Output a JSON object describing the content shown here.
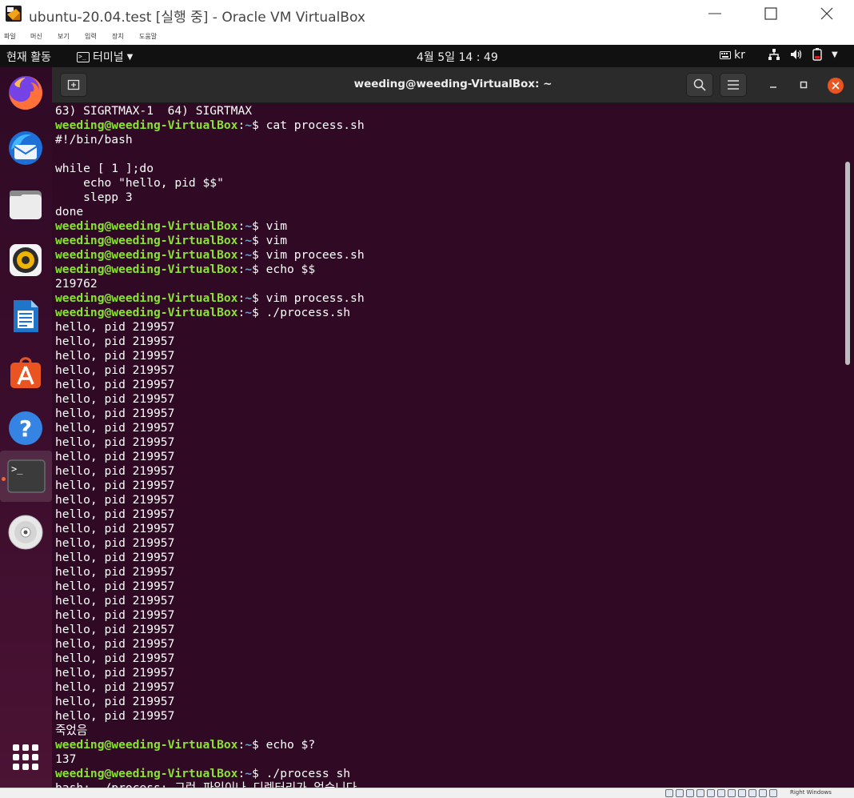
{
  "vbox": {
    "title": "ubuntu-20.04.test [실행 중] - Oracle VM VirtualBox",
    "menus": [
      "파일",
      "머신",
      "보기",
      "입력",
      "장치",
      "도움말"
    ],
    "host_key": "Right Windows"
  },
  "topbar": {
    "activities": "현재 활동",
    "app_menu": "터미널",
    "clock": "4월 5일  14 : 49",
    "keyboard": "kr"
  },
  "dock": {
    "items": [
      "firefox-icon",
      "thunderbird-icon",
      "files-icon",
      "rhythmbox-icon",
      "libreoffice-writer-icon",
      "software-center-icon",
      "help-icon",
      "terminal-icon",
      "dvd-icon"
    ]
  },
  "terminal": {
    "title": "weeding@weeding-VirtualBox: ~",
    "prompt_user": "weeding@weeding-VirtualBox",
    "prompt_path": "~",
    "lines": [
      {
        "type": "out",
        "text": "63) SIGRTMAX-1  64) SIGRTMAX"
      },
      {
        "type": "cmd",
        "text": "cat process.sh"
      },
      {
        "type": "out",
        "text": "#!/bin/bash"
      },
      {
        "type": "out",
        "text": ""
      },
      {
        "type": "out",
        "text": "while [ 1 ];do"
      },
      {
        "type": "out",
        "text": "    echo \"hello, pid $$\""
      },
      {
        "type": "out",
        "text": "    slepp 3"
      },
      {
        "type": "out",
        "text": "done"
      },
      {
        "type": "cmd",
        "text": "vim"
      },
      {
        "type": "cmd",
        "text": "vim"
      },
      {
        "type": "cmd",
        "text": "vim procees.sh"
      },
      {
        "type": "cmd",
        "text": "echo $$"
      },
      {
        "type": "out",
        "text": "219762"
      },
      {
        "type": "cmd",
        "text": "vim process.sh"
      },
      {
        "type": "cmd",
        "text": "./process.sh"
      },
      {
        "type": "out",
        "text": "hello, pid 219957"
      },
      {
        "type": "out",
        "text": "hello, pid 219957"
      },
      {
        "type": "out",
        "text": "hello, pid 219957"
      },
      {
        "type": "out",
        "text": "hello, pid 219957"
      },
      {
        "type": "out",
        "text": "hello, pid 219957"
      },
      {
        "type": "out",
        "text": "hello, pid 219957"
      },
      {
        "type": "out",
        "text": "hello, pid 219957"
      },
      {
        "type": "out",
        "text": "hello, pid 219957"
      },
      {
        "type": "out",
        "text": "hello, pid 219957"
      },
      {
        "type": "out",
        "text": "hello, pid 219957"
      },
      {
        "type": "out",
        "text": "hello, pid 219957"
      },
      {
        "type": "out",
        "text": "hello, pid 219957"
      },
      {
        "type": "out",
        "text": "hello, pid 219957"
      },
      {
        "type": "out",
        "text": "hello, pid 219957"
      },
      {
        "type": "out",
        "text": "hello, pid 219957"
      },
      {
        "type": "out",
        "text": "hello, pid 219957"
      },
      {
        "type": "out",
        "text": "hello, pid 219957"
      },
      {
        "type": "out",
        "text": "hello, pid 219957"
      },
      {
        "type": "out",
        "text": "hello, pid 219957"
      },
      {
        "type": "out",
        "text": "hello, pid 219957"
      },
      {
        "type": "out",
        "text": "hello, pid 219957"
      },
      {
        "type": "out",
        "text": "hello, pid 219957"
      },
      {
        "type": "out",
        "text": "hello, pid 219957"
      },
      {
        "type": "out",
        "text": "hello, pid 219957"
      },
      {
        "type": "out",
        "text": "hello, pid 219957"
      },
      {
        "type": "out",
        "text": "hello, pid 219957"
      },
      {
        "type": "out",
        "text": "hello, pid 219957"
      },
      {
        "type": "out",
        "text": "hello, pid 219957"
      },
      {
        "type": "out",
        "text": "죽었음"
      },
      {
        "type": "cmd",
        "text": "echo $?"
      },
      {
        "type": "out",
        "text": "137"
      },
      {
        "type": "cmd",
        "text": "./process sh"
      },
      {
        "type": "out",
        "text": "bash: ./process: 그런 파일이나 디렉터리가 없습니다"
      }
    ]
  },
  "colors": {
    "terminal_bg": "#300a24",
    "prompt_user": "#8ae234",
    "prompt_path": "#729fcf",
    "accent": "#e95420"
  }
}
